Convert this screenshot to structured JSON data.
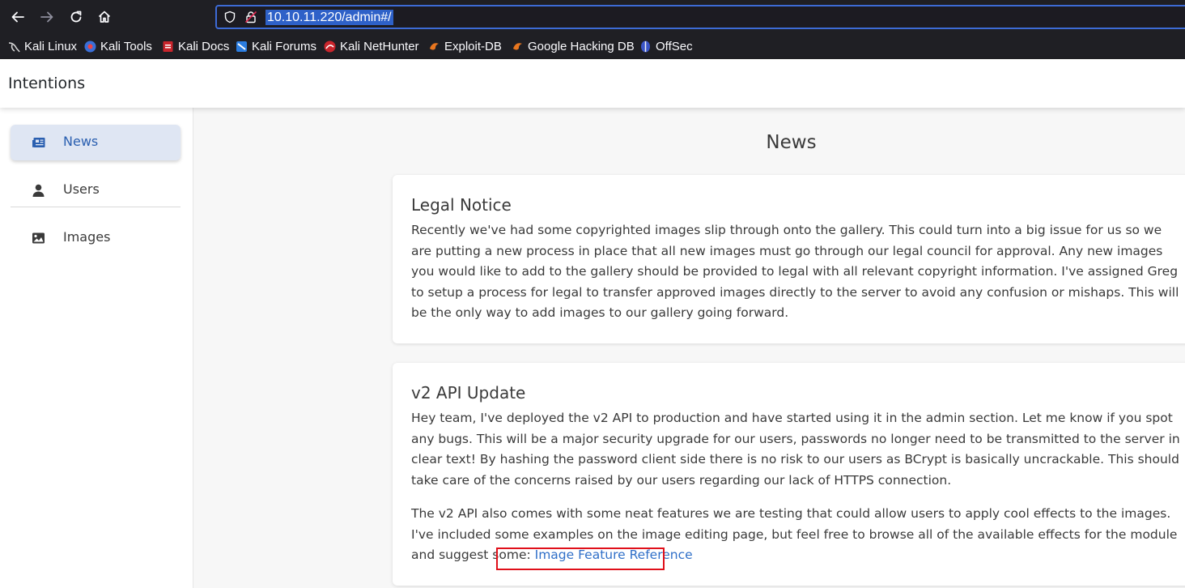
{
  "browser": {
    "url": "10.10.11.220/admin#/",
    "bookmarks": [
      {
        "label": "Kali Linux",
        "icon": "kali-dragon-icon"
      },
      {
        "label": "Kali Tools",
        "icon": "kali-tools-icon"
      },
      {
        "label": "Kali Docs",
        "icon": "kali-docs-icon"
      },
      {
        "label": "Kali Forums",
        "icon": "kali-forums-icon"
      },
      {
        "label": "Kali NetHunter",
        "icon": "kali-nethunter-icon"
      },
      {
        "label": "Exploit-DB",
        "icon": "exploit-db-icon"
      },
      {
        "label": "Google Hacking DB",
        "icon": "ghdb-icon"
      },
      {
        "label": "OffSec",
        "icon": "offsec-icon"
      }
    ]
  },
  "app": {
    "title": "Intentions"
  },
  "sidebar": {
    "items": [
      {
        "label": "News",
        "icon": "newspaper-icon",
        "active": true
      },
      {
        "label": "Users",
        "icon": "user-icon",
        "active": false
      },
      {
        "label": "Images",
        "icon": "image-icon",
        "active": false
      }
    ]
  },
  "main": {
    "title": "News",
    "cards": [
      {
        "title": "Legal Notice",
        "body": "Recently we've had some copyrighted images slip through onto the gallery. This could turn into a big issue for us so we are putting a new process in place that all new images must go through our legal council for approval. Any new images you would like to add to the gallery should be provided to legal with all relevant copyright information. I've assigned Greg to setup a process for legal to transfer approved images directly to the server to avoid any confusion or mishaps. This will be the only way to add images to our gallery going forward."
      },
      {
        "title": "v2 API Update",
        "body": "Hey team, I've deployed the v2 API to production and have started using it in the admin section. Let me know if you spot any bugs. This will be a major security upgrade for our users, passwords no longer need to be transmitted to the server in clear text! By hashing the password client side there is no risk to our users as BCrypt is basically uncrackable. This should take care of the concerns raised by our users regarding our lack of HTTPS connection.",
        "body2": "The v2 API also comes with some neat features we are testing that could allow users to apply cool effects to the images. I've included some examples on the image editing page, but feel free to browse all of the available effects for the module and suggest some:",
        "link": "Image Feature Reference"
      }
    ]
  },
  "colors": {
    "accent": "#2f6fc8",
    "highlight": "#e0101a",
    "chrome": "#1f1f24"
  }
}
